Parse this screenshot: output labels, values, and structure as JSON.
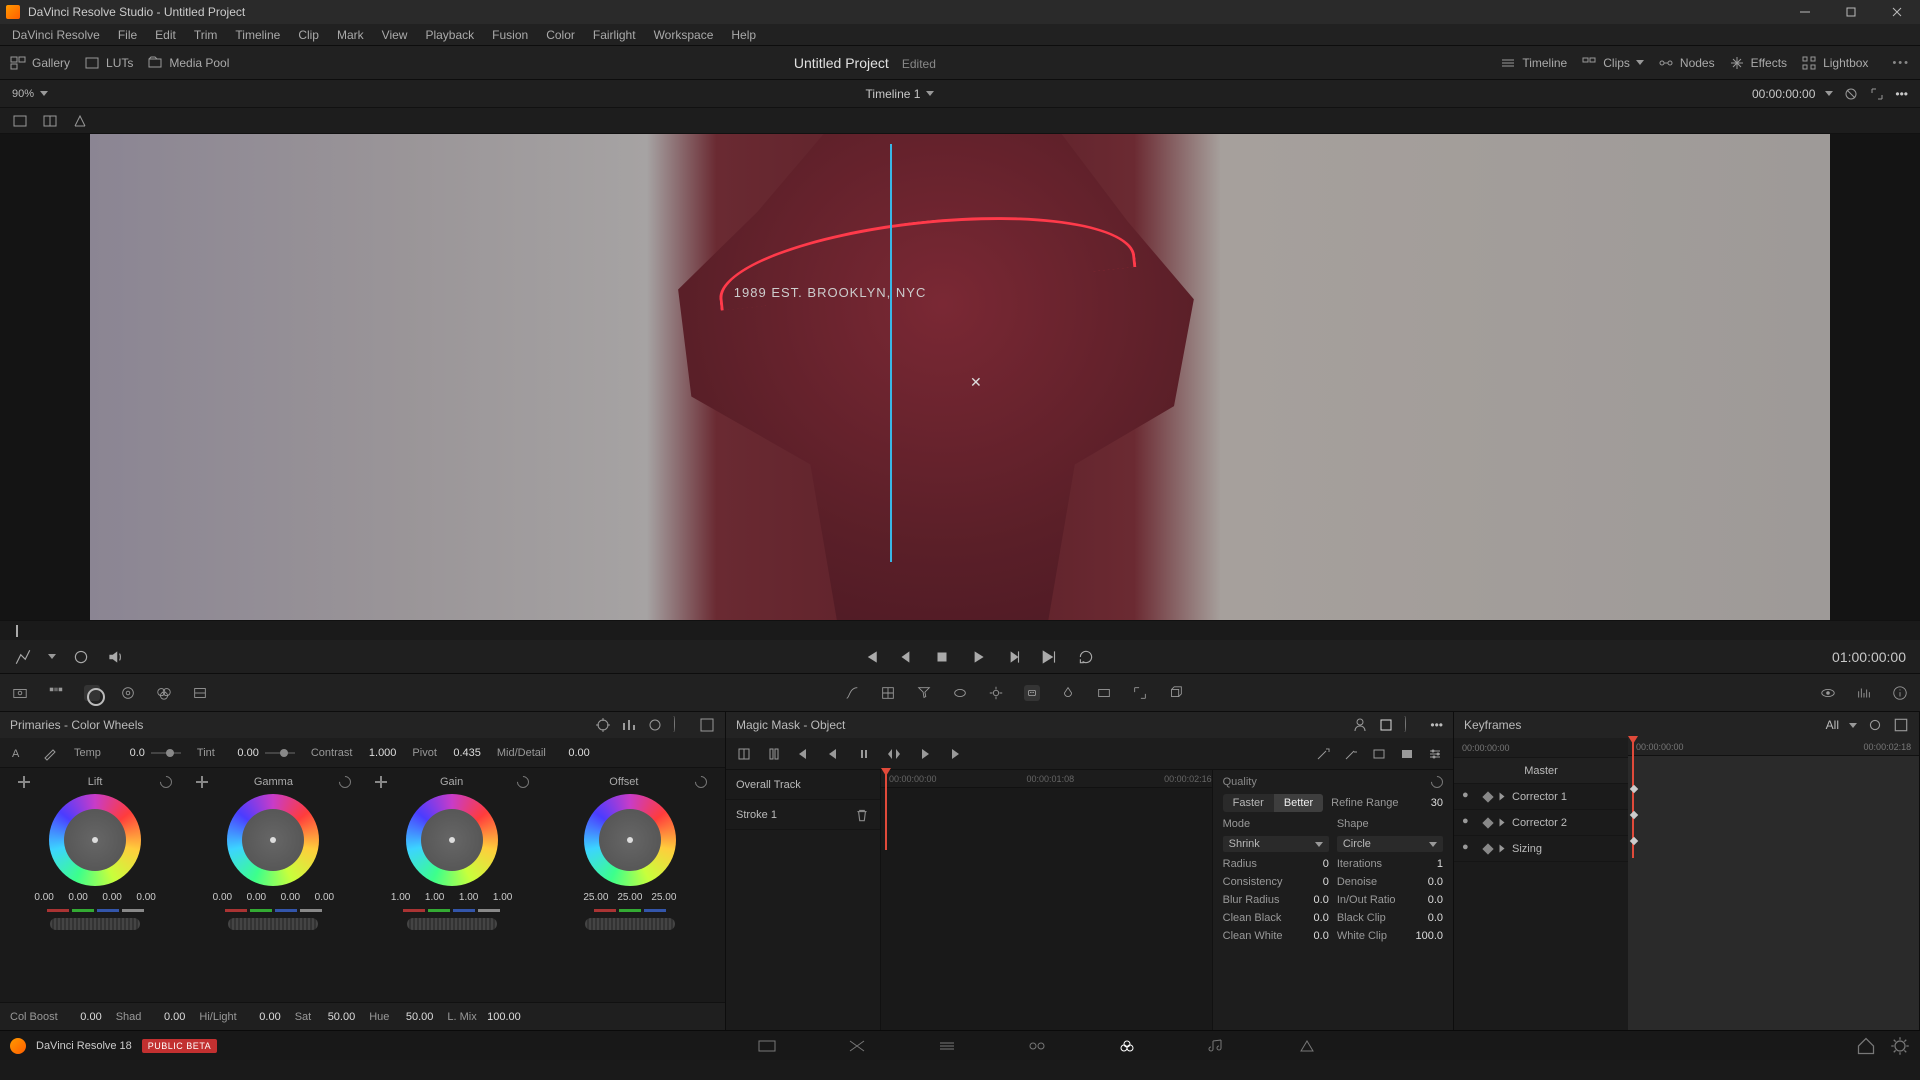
{
  "titlebar": {
    "text": "DaVinci Resolve Studio - Untitled Project"
  },
  "menu": [
    "DaVinci Resolve",
    "File",
    "Edit",
    "Trim",
    "Timeline",
    "Clip",
    "Mark",
    "View",
    "Playback",
    "Fusion",
    "Color",
    "Fairlight",
    "Workspace",
    "Help"
  ],
  "pagetb": {
    "left": [
      "Gallery",
      "LUTs",
      "Media Pool"
    ],
    "project": "Untitled Project",
    "edited": "Edited",
    "right": [
      "Timeline",
      "Clips",
      "Nodes",
      "Effects",
      "Lightbox"
    ]
  },
  "viewer": {
    "zoom": "90%",
    "timeline_name": "Timeline 1",
    "tc": "00:00:00:00",
    "shirt_text": "1989 EST. BROOKLYN, NYC"
  },
  "transport": {
    "tc": "01:00:00:00"
  },
  "primaries": {
    "title": "Primaries - Color Wheels",
    "adj": {
      "temp_l": "Temp",
      "temp_v": "0.0",
      "tint_l": "Tint",
      "tint_v": "0.00",
      "contrast_l": "Contrast",
      "contrast_v": "1.000",
      "pivot_l": "Pivot",
      "pivot_v": "0.435",
      "md_l": "Mid/Detail",
      "md_v": "0.00"
    },
    "wheels": [
      {
        "name": "Lift",
        "vals": [
          "0.00",
          "0.00",
          "0.00",
          "0.00"
        ]
      },
      {
        "name": "Gamma",
        "vals": [
          "0.00",
          "0.00",
          "0.00",
          "0.00"
        ]
      },
      {
        "name": "Gain",
        "vals": [
          "1.00",
          "1.00",
          "1.00",
          "1.00"
        ]
      },
      {
        "name": "Offset",
        "vals": [
          "25.00",
          "25.00",
          "25.00"
        ]
      }
    ],
    "bottom": {
      "cb_l": "Col Boost",
      "cb_v": "0.00",
      "shad_l": "Shad",
      "shad_v": "0.00",
      "hl_l": "Hi/Light",
      "hl_v": "0.00",
      "sat_l": "Sat",
      "sat_v": "50.00",
      "hue_l": "Hue",
      "hue_v": "50.00",
      "lm_l": "L. Mix",
      "lm_v": "100.00"
    }
  },
  "magic": {
    "title": "Magic Mask - Object",
    "tracks": {
      "overall": "Overall Track",
      "stroke1": "Stroke 1"
    },
    "ruler": [
      "00:00:00:00",
      "00:00:01:08",
      "00:00:02:16"
    ],
    "props": {
      "quality": "Quality",
      "faster": "Faster",
      "better": "Better",
      "refine": "Refine Range",
      "refine_v": "30",
      "mode": "Mode",
      "shape": "Shape",
      "shrink": "Shrink",
      "circle": "Circle",
      "radius": "Radius",
      "radius_v": "0",
      "iter": "Iterations",
      "iter_v": "1",
      "cons": "Consistency",
      "cons_v": "0",
      "den": "Denoise",
      "den_v": "0.0",
      "blur": "Blur Radius",
      "blur_v": "0.0",
      "io": "In/Out Ratio",
      "io_v": "0.0",
      "cblk": "Clean Black",
      "cblk_v": "0.0",
      "bclip": "Black Clip",
      "bclip_v": "0.0",
      "cwht": "Clean White",
      "cwht_v": "0.0",
      "wclip": "White Clip",
      "wclip_v": "100.0"
    }
  },
  "keyframes": {
    "title": "Keyframes",
    "all": "All",
    "ruler": [
      "00:00:00:00",
      "00:00:02:18"
    ],
    "rows": [
      "Master",
      "Corrector 1",
      "Corrector 2",
      "Sizing"
    ]
  },
  "footer": {
    "product": "DaVinci Resolve 18",
    "badge": "PUBLIC BETA"
  }
}
